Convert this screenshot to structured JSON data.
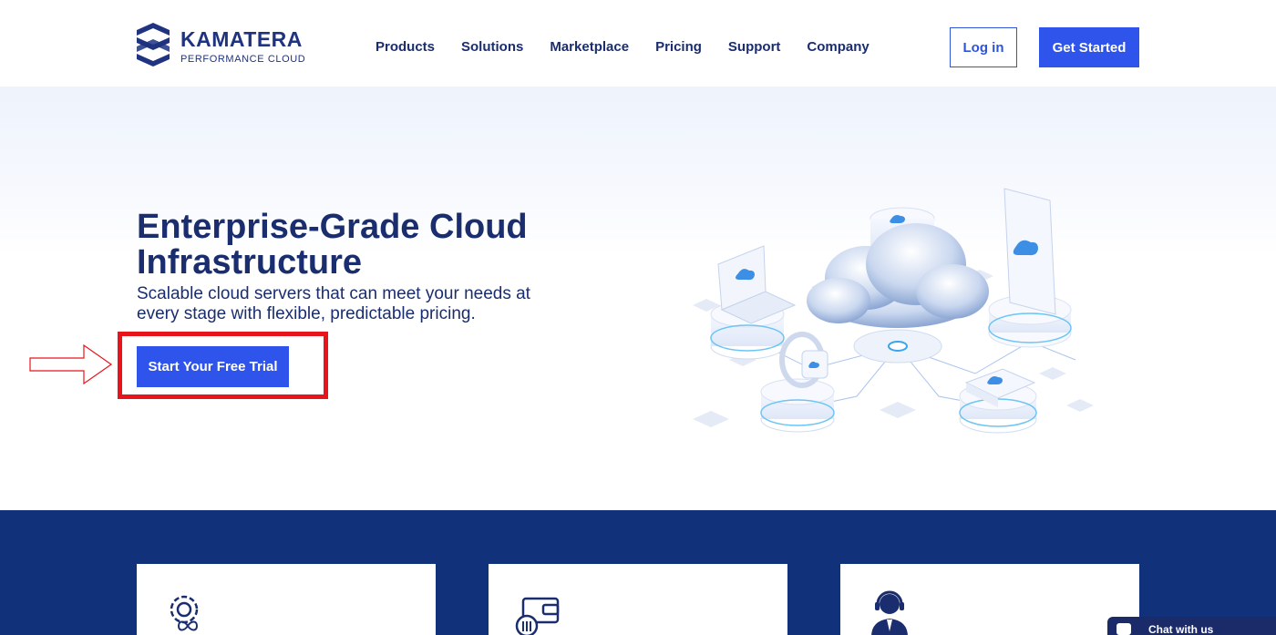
{
  "header": {
    "brand_name": "KAMATERA",
    "brand_tagline": "PERFORMANCE CLOUD",
    "nav": [
      "Products",
      "Solutions",
      "Marketplace",
      "Pricing",
      "Support",
      "Company"
    ],
    "login_label": "Log in",
    "get_started_label": "Get Started"
  },
  "hero": {
    "title": "Enterprise-Grade Cloud Infrastructure",
    "subtitle": "Scalable cloud servers that can meet your needs at every stage with flexible, predictable pricing.",
    "cta_label": "Start Your Free Trial"
  },
  "features": {
    "icons": [
      "gear-infinity-icon",
      "wallet-controls-icon",
      "support-agent-icon"
    ]
  },
  "chat": {
    "label": "Chat with us"
  },
  "colors": {
    "brand_navy": "#1a2d6e",
    "accent_blue": "#2f54eb",
    "band_navy": "#12317b",
    "highlight_red": "#e8141b"
  }
}
